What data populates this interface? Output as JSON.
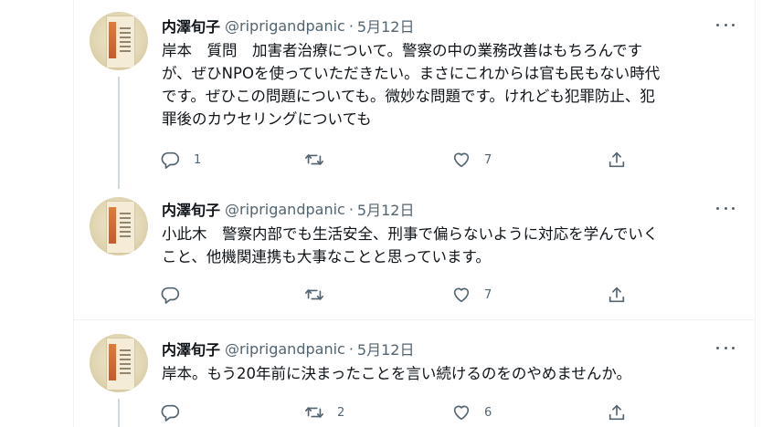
{
  "tweets": [
    {
      "author_name": "内澤旬子",
      "handle": "@riprigandpanic",
      "separator": "·",
      "date": "5月12日",
      "text": "岸本　質問　加害者治療について。警察の中の業務改善はもちろんです\nが、ぜひNPOを使っていただきたい。まさにこれからは官も民もない時代\nです。ぜひこの問題についても。微妙な問題です。けれども犯罪防止、犯\n罪後のカウセリングについても",
      "reply_count": "1",
      "retweet_count": "",
      "like_count": "7",
      "icons": [
        "reply-icon",
        "retweet-icon",
        "like-icon",
        "share-icon",
        "more-icon"
      ]
    },
    {
      "author_name": "内澤旬子",
      "handle": "@riprigandpanic",
      "separator": "·",
      "date": "5月12日",
      "text": "小此木　警察内部でも生活安全、刑事で偏らないように対応を学んでいく\nこと、他機関連携も大事なことと思っています。",
      "reply_count": "",
      "retweet_count": "",
      "like_count": "7",
      "icons": [
        "reply-icon",
        "retweet-icon",
        "like-icon",
        "share-icon",
        "more-icon"
      ]
    },
    {
      "author_name": "内澤旬子",
      "handle": "@riprigandpanic",
      "separator": "·",
      "date": "5月12日",
      "text": "岸本。もう20年前に決まったことを言い続けるのをのやめませんか。",
      "reply_count": "",
      "retweet_count": "2",
      "like_count": "6",
      "icons": [
        "reply-icon",
        "retweet-icon",
        "like-icon",
        "share-icon",
        "more-icon"
      ]
    }
  ],
  "colors": {
    "text_primary": "#0f1419",
    "text_secondary": "#536471",
    "border": "#eff3f4",
    "thread_line": "#cfd9de"
  }
}
